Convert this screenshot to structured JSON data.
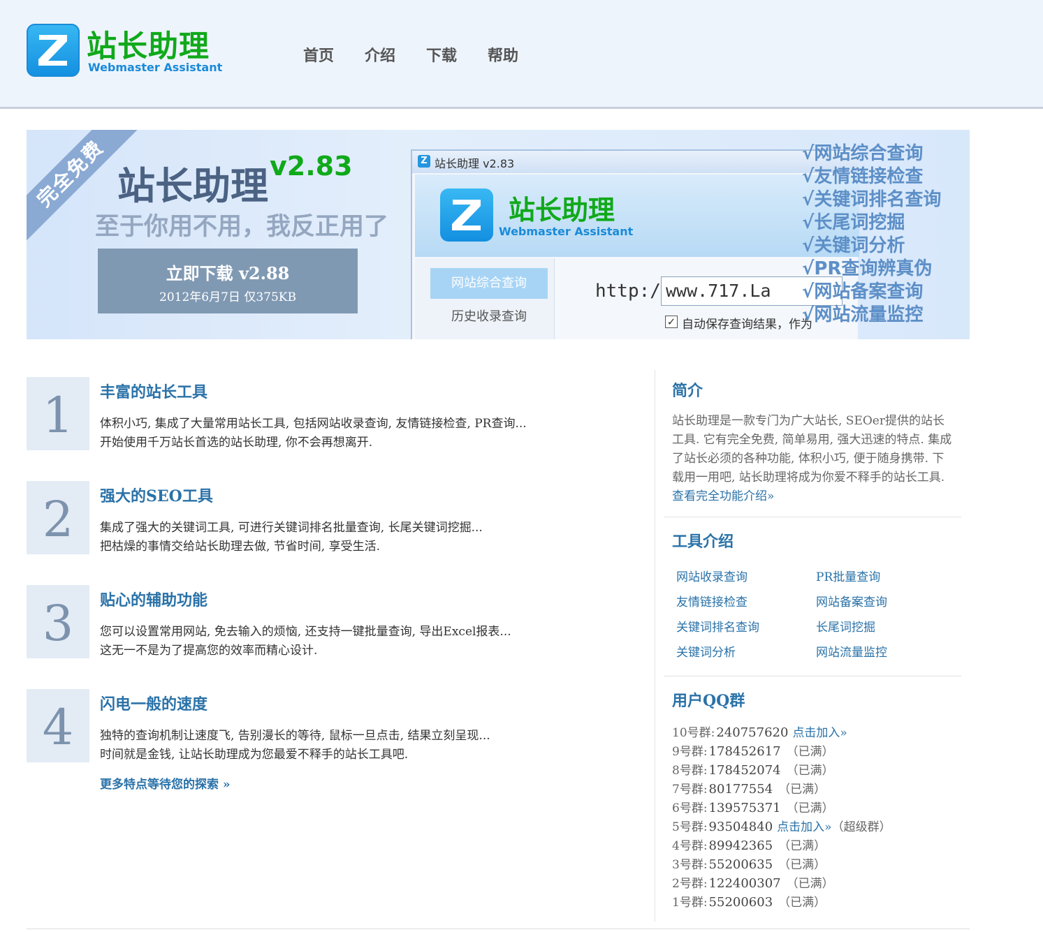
{
  "header": {
    "logo_cn": "站长助理",
    "logo_en": "Webmaster Assistant",
    "nav": [
      "首页",
      "介绍",
      "下载",
      "帮助"
    ]
  },
  "banner": {
    "ribbon": "完全免费",
    "title": "站长助理",
    "version": "v2.83",
    "slogan": "至于你用不用，我反正用了",
    "download_title": "立即下载 v2.88",
    "download_meta": "2012年6月7日 仅375KB",
    "app": {
      "window_title": "站长助理 v2.83",
      "logo_cn": "站长助理",
      "logo_en": "Webmaster Assistant",
      "tab_active": "网站综合查询",
      "tab_2": "历史收录查询",
      "http_label": "http://",
      "url_value": "www.717.La",
      "checkbox_label": "自动保存查询结果，作为"
    },
    "feature_list": [
      "√网站综合查询",
      "√友情链接检查",
      "√关键词排名查询",
      "√长尾词挖掘",
      "√关键词分析",
      "√PR查询辨真伪",
      "√网站备案查询",
      "√网站流量监控"
    ]
  },
  "features": [
    {
      "num": "1",
      "title": "丰富的站长工具",
      "line1": "体积小巧, 集成了大量常用站长工具, 包括网站收录查询, 友情链接检查, PR查询...",
      "line2": "开始使用千万站长首选的站长助理, 你不会再想离开."
    },
    {
      "num": "2",
      "title": "强大的SEO工具",
      "line1": "集成了强大的关键词工具, 可进行关键词排名批量查询, 长尾关键词挖掘...",
      "line2": "把枯燥的事情交给站长助理去做, 节省时间, 享受生活."
    },
    {
      "num": "3",
      "title": "贴心的辅助功能",
      "line1": "您可以设置常用网站, 免去输入的烦恼, 还支持一键批量查询, 导出Excel报表...",
      "line2": "这无一不是为了提高您的效率而精心设计."
    },
    {
      "num": "4",
      "title": "闪电一般的速度",
      "line1": "独特的查询机制让速度飞, 告别漫长的等待, 鼠标一旦点击, 结果立刻呈现...",
      "line2": "时间就是金钱, 让站长助理成为您最爱不释手的站长工具吧."
    }
  ],
  "more_link": "更多特点等待您的探索 »",
  "intro": {
    "title": "简介",
    "text": "站长助理是一款专门为广大站长, SEOer提供的站长工具. 它有完全免费, 简单易用, 强大迅速的特点. 集成了站长必须的各种功能, 体积小巧, 便于随身携带. 下载用一用吧, 站长助理将成为你爱不释手的站长工具. ",
    "link": "查看完全功能介绍»"
  },
  "tools": {
    "title": "工具介绍",
    "items": [
      "网站收录查询",
      "PR批量查询",
      "友情链接检查",
      "网站备案查询",
      "关键词排名查询",
      "长尾词挖掘",
      "关键词分析",
      "网站流量监控"
    ]
  },
  "qq": {
    "title": "用户QQ群",
    "groups": [
      {
        "label": "10号群:",
        "number": "240757620",
        "join": "点击加入»",
        "status": ""
      },
      {
        "label": "9号群:",
        "number": "178452617",
        "join": "",
        "status": "（已满）"
      },
      {
        "label": "8号群:",
        "number": "178452074",
        "join": "",
        "status": "（已满）"
      },
      {
        "label": "7号群:",
        "number": "80177554",
        "join": "",
        "status": "（已满）"
      },
      {
        "label": "6号群:",
        "number": "139575371",
        "join": "",
        "status": "（已满）"
      },
      {
        "label": "5号群:",
        "number": "93504840",
        "join": "点击加入»",
        "status": "（超级群）"
      },
      {
        "label": "4号群:",
        "number": "89942365",
        "join": "",
        "status": "（已满）"
      },
      {
        "label": "3号群:",
        "number": "55200635",
        "join": "",
        "status": "（已满）"
      },
      {
        "label": "2号群:",
        "number": "122400307",
        "join": "",
        "status": "（已满）"
      },
      {
        "label": "1号群:",
        "number": "55200603",
        "join": "",
        "status": "（已满）"
      }
    ]
  }
}
